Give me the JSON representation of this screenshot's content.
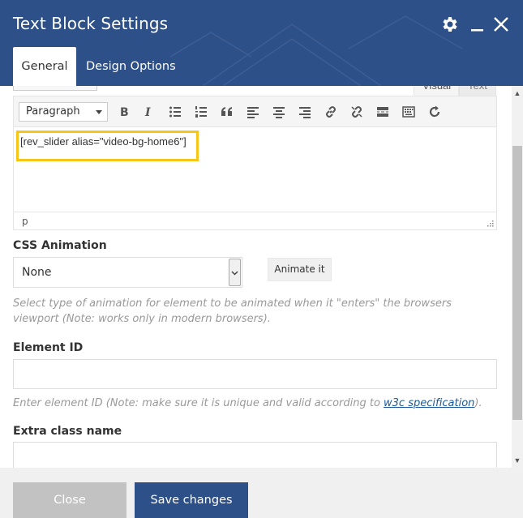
{
  "colors": {
    "header": "#2e5088",
    "accent": "#f5c518",
    "link": "#1a5a9b"
  },
  "header": {
    "title": "Text Block Settings",
    "icons": [
      "gear-icon",
      "minimize-icon",
      "close-icon"
    ],
    "tabs": [
      {
        "label": "General",
        "active": true
      },
      {
        "label": "Design Options",
        "active": false
      }
    ]
  },
  "editor": {
    "tabs": [
      {
        "label": "Visual"
      },
      {
        "label": "Text"
      }
    ],
    "format_select": "Paragraph",
    "toolbar_icons": [
      "bold-icon",
      "italic-icon",
      "bullet-list-icon",
      "numbered-list-icon",
      "blockquote-icon",
      "align-left-icon",
      "align-center-icon",
      "align-right-icon",
      "link-icon",
      "unlink-icon",
      "read-more-icon",
      "toolbar-toggle-icon",
      "refresh-icon"
    ],
    "content": "[rev_slider alias=\"video-bg-home6\"]",
    "path": "p"
  },
  "css_animation": {
    "label": "CSS Animation",
    "value": "None",
    "animate_button": "Animate it",
    "help": "Select type of animation for element to be animated when it \"enters\" the browsers viewport (Note: works only in modern browsers)."
  },
  "element_id": {
    "label": "Element ID",
    "value": "",
    "help_prefix": "Enter element ID (Note: make sure it is unique and valid according to ",
    "help_link": "w3c specification",
    "help_suffix": ")."
  },
  "extra_class": {
    "label": "Extra class name",
    "value": ""
  },
  "footer": {
    "close_label": "Close",
    "save_label": "Save changes"
  }
}
